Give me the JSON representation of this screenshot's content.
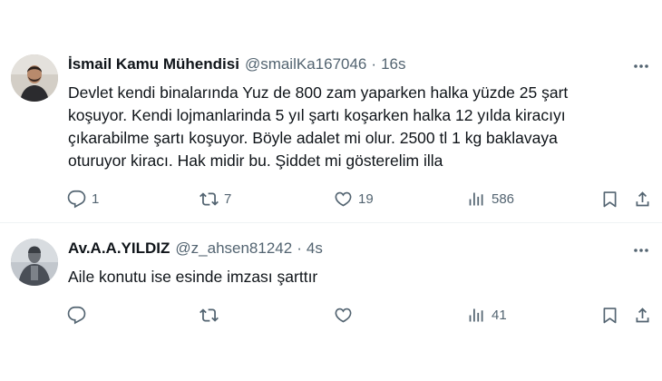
{
  "tweets": [
    {
      "name": "İsmail Kamu Mühendisi",
      "handle": "@smailKa167046",
      "dot": "·",
      "time": "16s",
      "text_lines": [
        "Devlet kendi binalarında Yuz de 800 zam yaparken halka yüzde 25 şart",
        "koşuyor. Kendi lojmanlarinda 5 yıl şartı koşarken halka 12 yılda kiracıyı",
        "çıkarabilme şartı koşuyor. Böyle adalet mi olur. 2500 tl 1 kg baklavaya",
        "oturuyor kiracı. Hak midir bu. Şiddet mi gösterelim illa"
      ],
      "replies": "1",
      "reposts": "7",
      "likes": "19",
      "views": "586"
    },
    {
      "name": "Av.A.A.YILDIZ",
      "handle": "@z_ahsen81242",
      "dot": "·",
      "time": "4s",
      "text_lines": [
        "Aile konutu ise esinde imzası şarttır"
      ],
      "replies": "",
      "reposts": "",
      "likes": "",
      "views": "41"
    }
  ],
  "icons": {
    "more": "more-icon",
    "reply": "reply-icon",
    "repost": "repost-icon",
    "like": "heart-icon",
    "views": "views-icon",
    "bookmark": "bookmark-icon",
    "share": "share-icon"
  },
  "colors": {
    "text": "#0f1419",
    "secondary": "#536471",
    "divider": "#eff3f4"
  }
}
